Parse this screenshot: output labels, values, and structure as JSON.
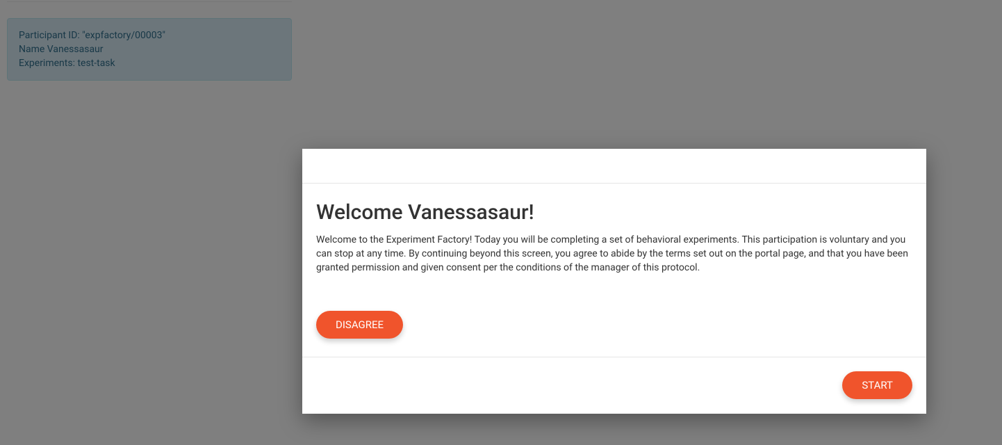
{
  "info": {
    "participant_line": "Participant ID: \"expfactory/00003\"",
    "name_line": "Name Vanessasaur",
    "experiments_line": "Experiments: test-task"
  },
  "modal": {
    "title": "Welcome Vanessasaur!",
    "body": "Welcome to the Experiment Factory! Today you will be completing a set of behavioral experiments. This participation is voluntary and you can stop at any time. By continuing beyond this screen, you agree to abide by the terms set out on the portal page, and that you have been granted permission and given consent per the conditions of the manager of this protocol.",
    "disagree_label": "DISAGREE",
    "start_label": "START"
  }
}
